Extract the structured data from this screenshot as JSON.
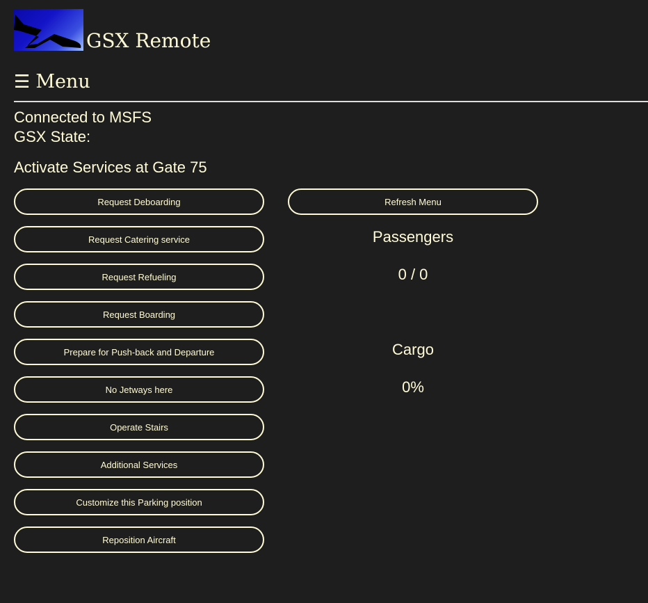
{
  "app": {
    "title": "GSX Remote",
    "logo_icon": "airplane-logo-icon"
  },
  "menu": {
    "icon": "hamburger-icon",
    "glyph": "☰",
    "label": "Menu"
  },
  "status": {
    "connection": "Connected to MSFS",
    "gsx_state": "GSX State:"
  },
  "gate": {
    "heading": "Activate Services at Gate 75"
  },
  "services": [
    "Request Deboarding",
    "Request Catering service",
    "Request Refueling",
    "Request Boarding",
    "Prepare for Push-back and Departure",
    "No Jetways here",
    "Operate Stairs",
    "Additional Services",
    "Customize this Parking position",
    "Reposition Aircraft"
  ],
  "refresh": {
    "label": "Refresh Menu"
  },
  "passengers": {
    "label": "Passengers",
    "value": "0 / 0"
  },
  "cargo": {
    "label": "Cargo",
    "value": "0%"
  },
  "colors": {
    "background": "#1e1e1e",
    "text": "#fffbd6",
    "logo_blue": "#1414c8"
  }
}
